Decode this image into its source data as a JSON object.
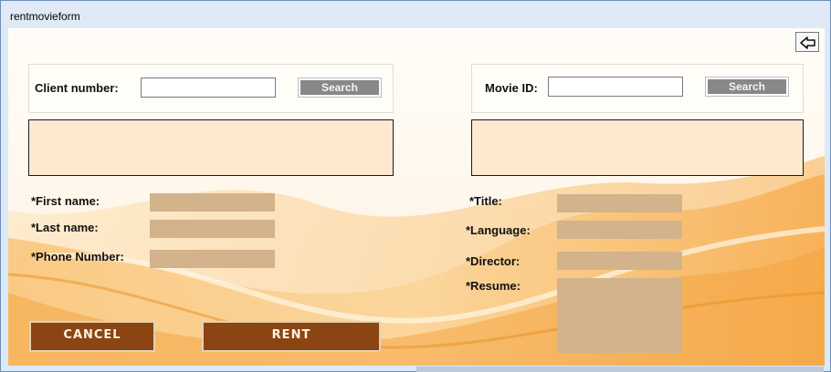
{
  "window": {
    "title": "rentmovieform"
  },
  "toolbar": {
    "back_icon": "back-arrow-icon"
  },
  "client_search": {
    "label": "Client number:",
    "value": "",
    "button_label": "Search"
  },
  "movie_search": {
    "label": "Movie ID:",
    "value": "",
    "button_label": "Search"
  },
  "client_fields": {
    "first_name": "*First name:",
    "last_name": "*Last name:",
    "phone_number": "*Phone Number:"
  },
  "movie_fields": {
    "title": "*Title:",
    "language": "*Language:",
    "director": "*Director:",
    "resume": "*Resume:"
  },
  "actions": {
    "cancel_label": "CANCEL",
    "rent_label": "RENT"
  },
  "colors": {
    "field_fill": "#d2b38c",
    "info_panel_fill": "#fde9d0",
    "button_fill": "#8b4513",
    "search_button_fill": "#888888"
  }
}
